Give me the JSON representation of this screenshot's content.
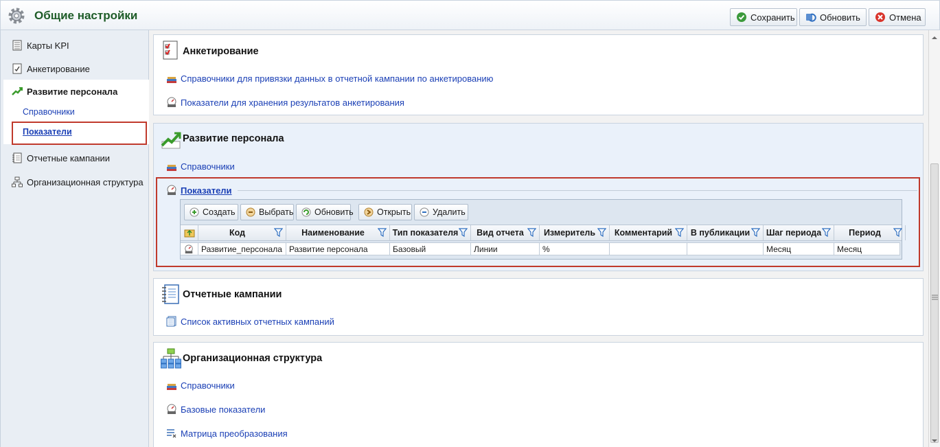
{
  "app": {
    "title": "Общие настройки",
    "icon": "gear-icon"
  },
  "toolbar": {
    "save_label": "Сохранить",
    "refresh_label": "Обновить",
    "cancel_label": "Отмена"
  },
  "sidebar": {
    "items": [
      {
        "label": "Карты KPI",
        "icon": "kpi-card-icon"
      },
      {
        "label": "Анкетирование",
        "icon": "checklist-icon"
      },
      {
        "label": "Развитие персонала",
        "icon": "growth-chart-icon"
      },
      {
        "label": "Отчетные кампании",
        "icon": "notebook-icon"
      },
      {
        "label": "Организационная структура",
        "icon": "org-structure-icon"
      }
    ],
    "sub_items": [
      {
        "label": "Справочники"
      },
      {
        "label": "Показатели",
        "selected": true
      }
    ]
  },
  "sections": {
    "survey": {
      "title": "Анкетирование",
      "links": [
        "Справочники для привязки данных в отчетной кампании по анкетированию",
        "Показатели для хранения результатов анкетирования"
      ]
    },
    "staff": {
      "title": "Развитие персонала",
      "links": [
        "Справочники"
      ],
      "indicators_label": "Показатели",
      "grid": {
        "buttons": {
          "create": "Создать",
          "choose": "Выбрать",
          "refresh": "Обновить",
          "open": "Открыть",
          "delete": "Удалить"
        },
        "columns": [
          "Код",
          "Наименование",
          "Тип показателя",
          "Вид отчета",
          "Измеритель",
          "Комментарий",
          "В публикации",
          "Шаг периода",
          "Период"
        ],
        "rows": [
          [
            "Развитие_персонала",
            "Развитие персонала",
            "Базовый",
            "Линии",
            "%",
            "",
            "",
            "Месяц",
            "Месяц"
          ]
        ]
      }
    },
    "campaigns": {
      "title": "Отчетные кампании",
      "links": [
        "Список активных отчетных кампаний"
      ]
    },
    "org": {
      "title": "Организационная структура",
      "links": [
        "Справочники",
        "Базовые показатели",
        "Матрица преобразования"
      ]
    }
  },
  "colors": {
    "title_green": "#1e5c28",
    "link_blue": "#1a3fb5",
    "highlight_red": "#c0392b",
    "sidebar_bg": "#e9eef4"
  }
}
